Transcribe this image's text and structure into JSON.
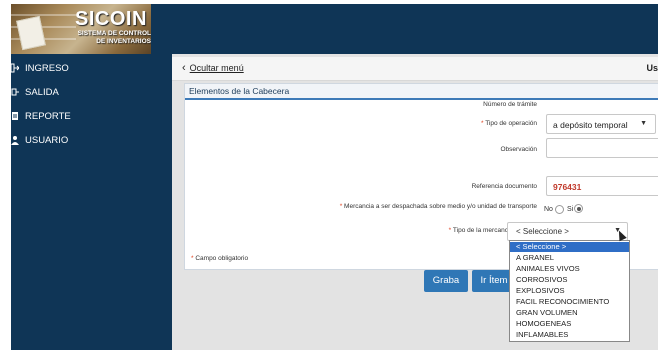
{
  "brand": {
    "title": "SICOIN",
    "subtitle_1": "SISTEMA DE CONTROL",
    "subtitle_2": "DE INVENTARIOS"
  },
  "sidebar": {
    "items": [
      {
        "label": "INGRESO",
        "icon": "login-icon"
      },
      {
        "label": "SALIDA",
        "icon": "logout-icon"
      },
      {
        "label": "REPORTE",
        "icon": "report-icon"
      },
      {
        "label": "USUARIO",
        "icon": "user-icon"
      }
    ]
  },
  "subbar": {
    "hide_menu": "Ocultar menú",
    "user_stub": "Us"
  },
  "panel": {
    "title": "Elementos de la Cabecera"
  },
  "form": {
    "tramite_label": "Número de trámite",
    "operacion_label": "Tipo de operación",
    "operacion_value": "a depósito temporal",
    "observacion_label": "Observación",
    "referencia_label": "Referencia documento",
    "referencia_value": "976431",
    "despachada_label": "Mercancia a ser despachada sobre medio y/o unidad de transporte",
    "no_label": "No",
    "si_label": "Si",
    "mercancia_label": "Tipo de la mercancia",
    "mercancia_value": "< Seleccione >",
    "required_mark": "*",
    "required_note": "Campo obligatorio"
  },
  "buttons": {
    "graba": "Graba",
    "ir_item": "Ir Ítem"
  },
  "dropdown": {
    "options": [
      "< Seleccione >",
      "A GRANEL",
      "ANIMALES VIVOS",
      "CORROSIVOS",
      "EXPLOSIVOS",
      "FACIL RECONOCIMIENTO",
      "GRAN VOLUMEN",
      "HOMOGENEAS",
      "INFLAMABLES"
    ],
    "selected_index": 0
  },
  "colors": {
    "sidebar_bg": "#0f3556",
    "accent": "#2f77b6",
    "required": "#e0401e",
    "reference_value": "#c0392b"
  }
}
